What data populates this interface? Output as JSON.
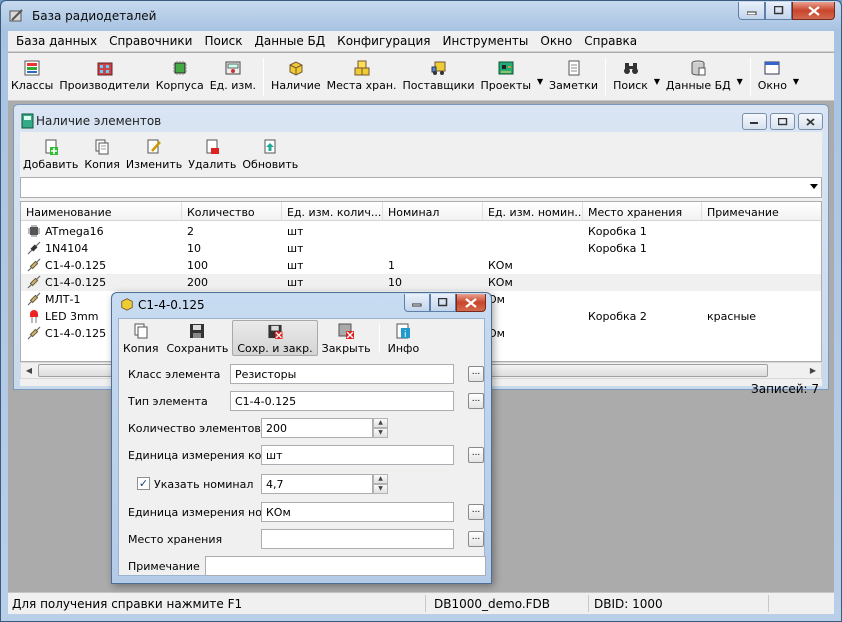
{
  "window": {
    "title": "База радиодеталей"
  },
  "menu": [
    "База данных",
    "Справочники",
    "Поиск",
    "Данные БД",
    "Конфигурация",
    "Инструменты",
    "Окно",
    "Справка"
  ],
  "toolbar": {
    "classes": "Классы",
    "manufacturers": "Производители",
    "packages": "Корпуса",
    "units": "Ед. изм.",
    "stock": "Наличие",
    "storage": "Места хран.",
    "suppliers": "Поставщики",
    "projects": "Проекты",
    "notes": "Заметки",
    "search": "Поиск",
    "db_data": "Данные БД",
    "window": "Окно"
  },
  "child": {
    "title": "Наличие элементов",
    "toolbar": {
      "add": "Добавить",
      "copy": "Копия",
      "edit": "Изменить",
      "delete": "Удалить",
      "refresh": "Обновить"
    },
    "filter_value": "",
    "columns": [
      "Наименование",
      "Количество",
      "Ед. изм. колич...",
      "Номинал",
      "Ед. изм. номин...",
      "Место хранения",
      "Примечание"
    ],
    "rows": [
      {
        "icon": "chip-icon",
        "name": "ATmega16",
        "qty": "2",
        "unit": "шт",
        "nominal": "",
        "nom_unit": "",
        "storage": "Коробка 1",
        "note": ""
      },
      {
        "icon": "diode-icon",
        "name": "1N4104",
        "qty": "10",
        "unit": "шт",
        "nominal": "",
        "nom_unit": "",
        "storage": "Коробка 1",
        "note": ""
      },
      {
        "icon": "resistor-icon",
        "name": "С1-4-0.125",
        "qty": "100",
        "unit": "шт",
        "nominal": "1",
        "nom_unit": "КОм",
        "storage": "",
        "note": ""
      },
      {
        "icon": "resistor-icon",
        "name": "С1-4-0.125",
        "qty": "200",
        "unit": "шт",
        "nominal": "10",
        "nom_unit": "КОм",
        "storage": "",
        "note": ""
      },
      {
        "icon": "resistor-icon",
        "name": "МЛТ-1",
        "qty": "",
        "unit": "",
        "nominal": "",
        "nom_unit": "Ом",
        "storage": "",
        "note": ""
      },
      {
        "icon": "led-icon",
        "name": "LED 3mm",
        "qty": "",
        "unit": "",
        "nominal": "",
        "nom_unit": "",
        "storage": "Коробка 2",
        "note": "красные"
      },
      {
        "icon": "resistor-icon",
        "name": "С1-4-0.125",
        "qty": "",
        "unit": "",
        "nominal": "",
        "nom_unit": "Ом",
        "storage": "",
        "note": ""
      }
    ],
    "records": "Записей: 7"
  },
  "dialog": {
    "title": "С1-4-0.125",
    "toolbar": {
      "copy": "Копия",
      "save": "Сохранить",
      "save_close": "Сохр. и закр.",
      "close": "Закрыть",
      "info": "Инфо"
    },
    "fields": {
      "class_label": "Класс элемента",
      "class_value": "Резисторы",
      "type_label": "Тип элемента",
      "type_value": "С1-4-0.125",
      "count_label": "Количество элементов",
      "count_value": "200",
      "unit_label": "Единица измерения кол.",
      "unit_value": "шт",
      "nominal_label": "Указать номинал",
      "nominal_checked": true,
      "nominal_value": "4,7",
      "nom_unit_label": "Единица измерения ном.",
      "nom_unit_value": "КОм",
      "storage_label": "Место хранения",
      "storage_value": "",
      "note_label": "Примечание",
      "note_value": ""
    }
  },
  "status": {
    "help": "Для получения справки нажмите F1",
    "db": "DB1000_demo.FDB",
    "dbid": "DBID: 1000"
  }
}
